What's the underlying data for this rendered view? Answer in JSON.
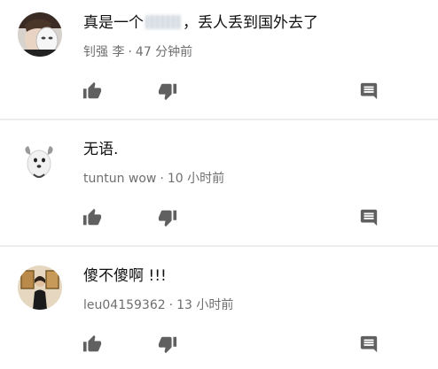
{
  "comments": [
    {
      "avatar": "avatar-boy-with-mask",
      "text_before": "真是一个",
      "text_after": "，丢人丢到国外去了",
      "author": "钊强 李",
      "separator": "·",
      "time": "47 分钟前"
    },
    {
      "avatar": "avatar-white-dog",
      "text": "无语.",
      "author": "tuntun wow",
      "separator": "·",
      "time": "10 小时前"
    },
    {
      "avatar": "avatar-woman-portrait",
      "text": "傻不傻啊 !!!",
      "author": "leu04159362",
      "separator": "·",
      "time": "13 小时前"
    }
  ],
  "icons": {
    "like": "thumb-up-icon",
    "dislike": "thumb-down-icon",
    "reply": "comment-reply-icon"
  },
  "colors": {
    "text": "#111111",
    "meta": "#6f6f6f",
    "icon": "#606060",
    "divider": "#ececec"
  }
}
